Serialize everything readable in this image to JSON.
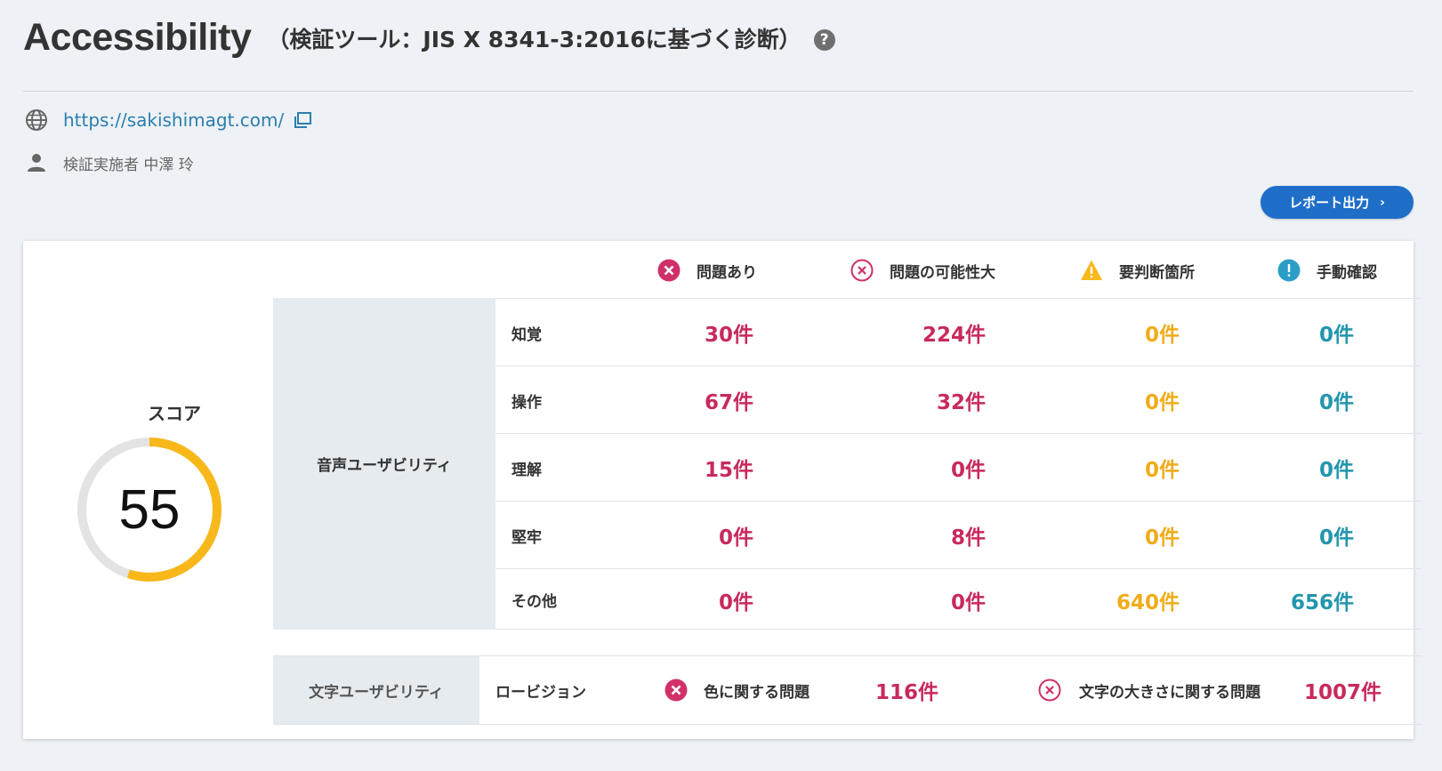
{
  "header": {
    "title": "Accessibility",
    "subtitle": "（検証ツール：JIS X 8341-3:2016に基づく診断）",
    "help_icon": "?"
  },
  "meta": {
    "url": "https://sakishimagt.com/",
    "inspector": "検証実施者  中澤 玲"
  },
  "actions": {
    "report_button": "レポート出力",
    "report_chevron": "›"
  },
  "score": {
    "label": "スコア",
    "value": "55",
    "percent": 55,
    "gauge_color": "#f8b81a",
    "track_color": "#e3e3e3"
  },
  "legend": [
    {
      "label": "問題あり",
      "icon": "error-filled-icon",
      "color": "#d0306a"
    },
    {
      "label": "問題の可能性大",
      "icon": "error-outline-icon",
      "color": "#d0306a"
    },
    {
      "label": "要判断箇所",
      "icon": "warning-icon",
      "color": "#f8b81a"
    },
    {
      "label": "手動確認",
      "icon": "info-icon",
      "color": "#2b9ec7"
    }
  ],
  "voice_usability": {
    "category": "音声ユーザビリティ",
    "rows": [
      {
        "label": "知覚",
        "issues": "30件",
        "likely": "224件",
        "judge": "0件",
        "manual": "0件"
      },
      {
        "label": "操作",
        "issues": "67件",
        "likely": "32件",
        "judge": "0件",
        "manual": "0件"
      },
      {
        "label": "理解",
        "issues": "15件",
        "likely": "0件",
        "judge": "0件",
        "manual": "0件"
      },
      {
        "label": "堅牢",
        "issues": "0件",
        "likely": "8件",
        "judge": "0件",
        "manual": "0件"
      },
      {
        "label": "その他",
        "issues": "0件",
        "likely": "0件",
        "judge": "640件",
        "manual": "656件"
      }
    ]
  },
  "text_usability": {
    "category": "文字ユーザビリティ",
    "low_vision": "ロービジョン",
    "color_issue_label": "色に関する問題",
    "color_issue_count": "116件",
    "size_issue_label": "文字の大きさに関する問題",
    "size_issue_count": "1007件"
  },
  "colors": {
    "error": "#c82a5c",
    "warning": "#f0ac1a",
    "manual": "#2296ad",
    "button": "#1f6fc9",
    "link": "#2b7fae"
  }
}
